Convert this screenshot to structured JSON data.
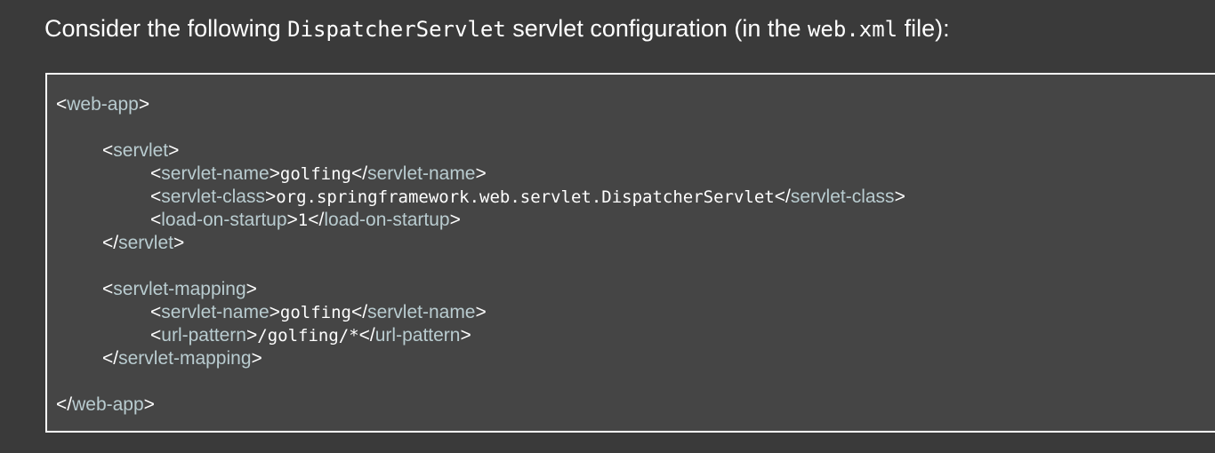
{
  "question": {
    "prefix": "Consider the following ",
    "class_name": "DispatcherServlet",
    "middle": " servlet configuration (in the ",
    "file_name": "web.xml",
    "suffix": " file):"
  },
  "code": {
    "web_app_tag": "web-app",
    "servlet_tag": "servlet",
    "servlet_name_tag": "servlet-name",
    "servlet_class_tag": "servlet-class",
    "load_on_startup_tag": "load-on-startup",
    "servlet_mapping_tag": "servlet-mapping",
    "url_pattern_tag": "url-pattern",
    "servlet_name_value": "golfing",
    "servlet_class_value": "org.springframework.web.servlet.DispatcherServlet",
    "load_on_startup_value": "1",
    "mapping_servlet_name_value": "golfing",
    "url_pattern_value": "/golfing/*"
  },
  "colors": {
    "background": "#3a3a3a",
    "code_background": "#454545",
    "tag_name": "#b9ccd0",
    "text": "#ffffff"
  }
}
